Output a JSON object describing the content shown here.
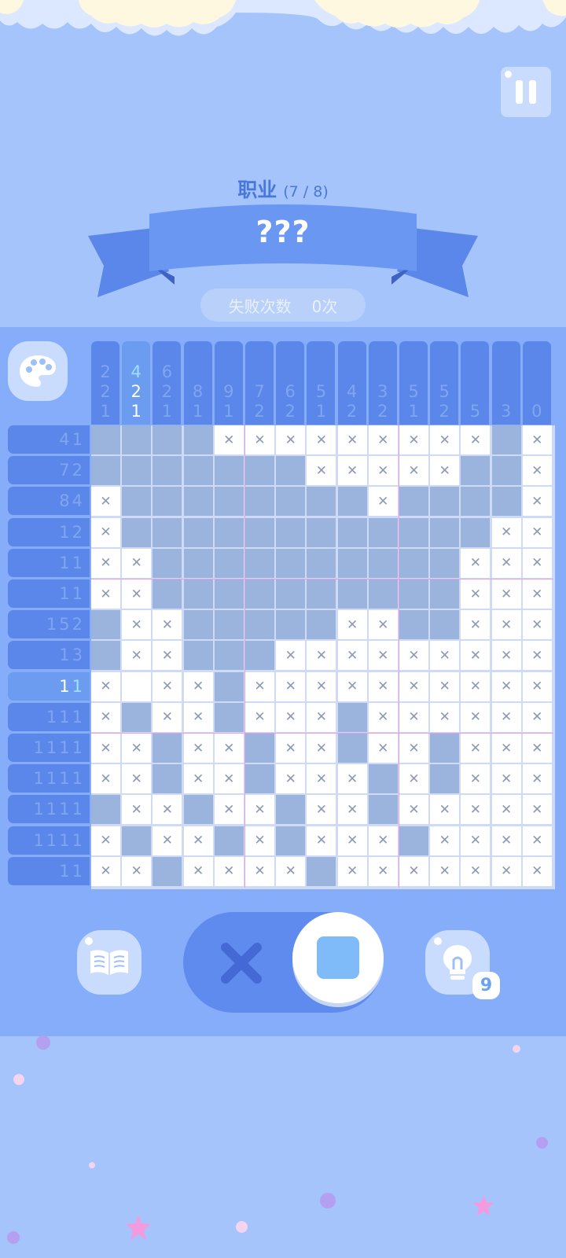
{
  "header": {
    "category": "职业",
    "progress": "(7 / 8)",
    "puzzle_name": "???",
    "fail_label": "失败次数",
    "fail_count": "0次"
  },
  "icons": {
    "pause": "pause-icon",
    "palette": "palette-icon",
    "book": "book-icon",
    "hint": "lightbulb-icon",
    "cross_mode": "cross-icon",
    "fill_mode": "square-icon"
  },
  "hint_count": "9",
  "mode": "fill",
  "highlight": {
    "column": 1,
    "row": 8
  },
  "colors": {
    "background": "#a4c4fb",
    "board": "#85adf9",
    "clue_bar": "#5b86ea",
    "filled_cell": "#9bb4de",
    "empty_cell": "#ffffff",
    "accent": "#4a78d8"
  },
  "column_clues": [
    [
      "2",
      "2",
      "1"
    ],
    [
      "4",
      "2",
      "1"
    ],
    [
      "6",
      "2",
      "1"
    ],
    [
      "8",
      "1"
    ],
    [
      "9",
      "1"
    ],
    [
      "7",
      "2"
    ],
    [
      "6",
      "2"
    ],
    [
      "5",
      "1"
    ],
    [
      "4",
      "2"
    ],
    [
      "3",
      "2"
    ],
    [
      "5",
      "1"
    ],
    [
      "5",
      "2"
    ],
    [
      "5"
    ],
    [
      "3"
    ],
    [
      "0"
    ]
  ],
  "row_clues": [
    "4 1",
    "7 2",
    "8 4",
    "1 2",
    "1 1",
    "1 1",
    "1 5 2",
    "1 3",
    "1 1",
    "1 1 1",
    "1 1 1 1",
    "1 1 1 1",
    "1 1 1 1",
    "1 1 1 1",
    "1 1"
  ],
  "grid": [
    "ffffxxxxxxxxxfx",
    "fffffffxxxxxffx",
    "xffffffffxffffx",
    "xffffffffffffxx",
    "xxffffffffffxxx",
    "xxffffffffffxxx",
    "fxxfffffxxffxxx",
    "fxxfffxxxxxxxxx",
    "xexxfxxxxxxxxxx",
    "xfxxfxxxfxxxxxx",
    "xxfxxfxxfxxfxxx",
    "xxfxxfxxxfxfxxx",
    "fxxfxxfxxfxxxxx",
    "xfxxfxfxxxfxxxx",
    "xxfxxxxfxxxxxxx"
  ]
}
